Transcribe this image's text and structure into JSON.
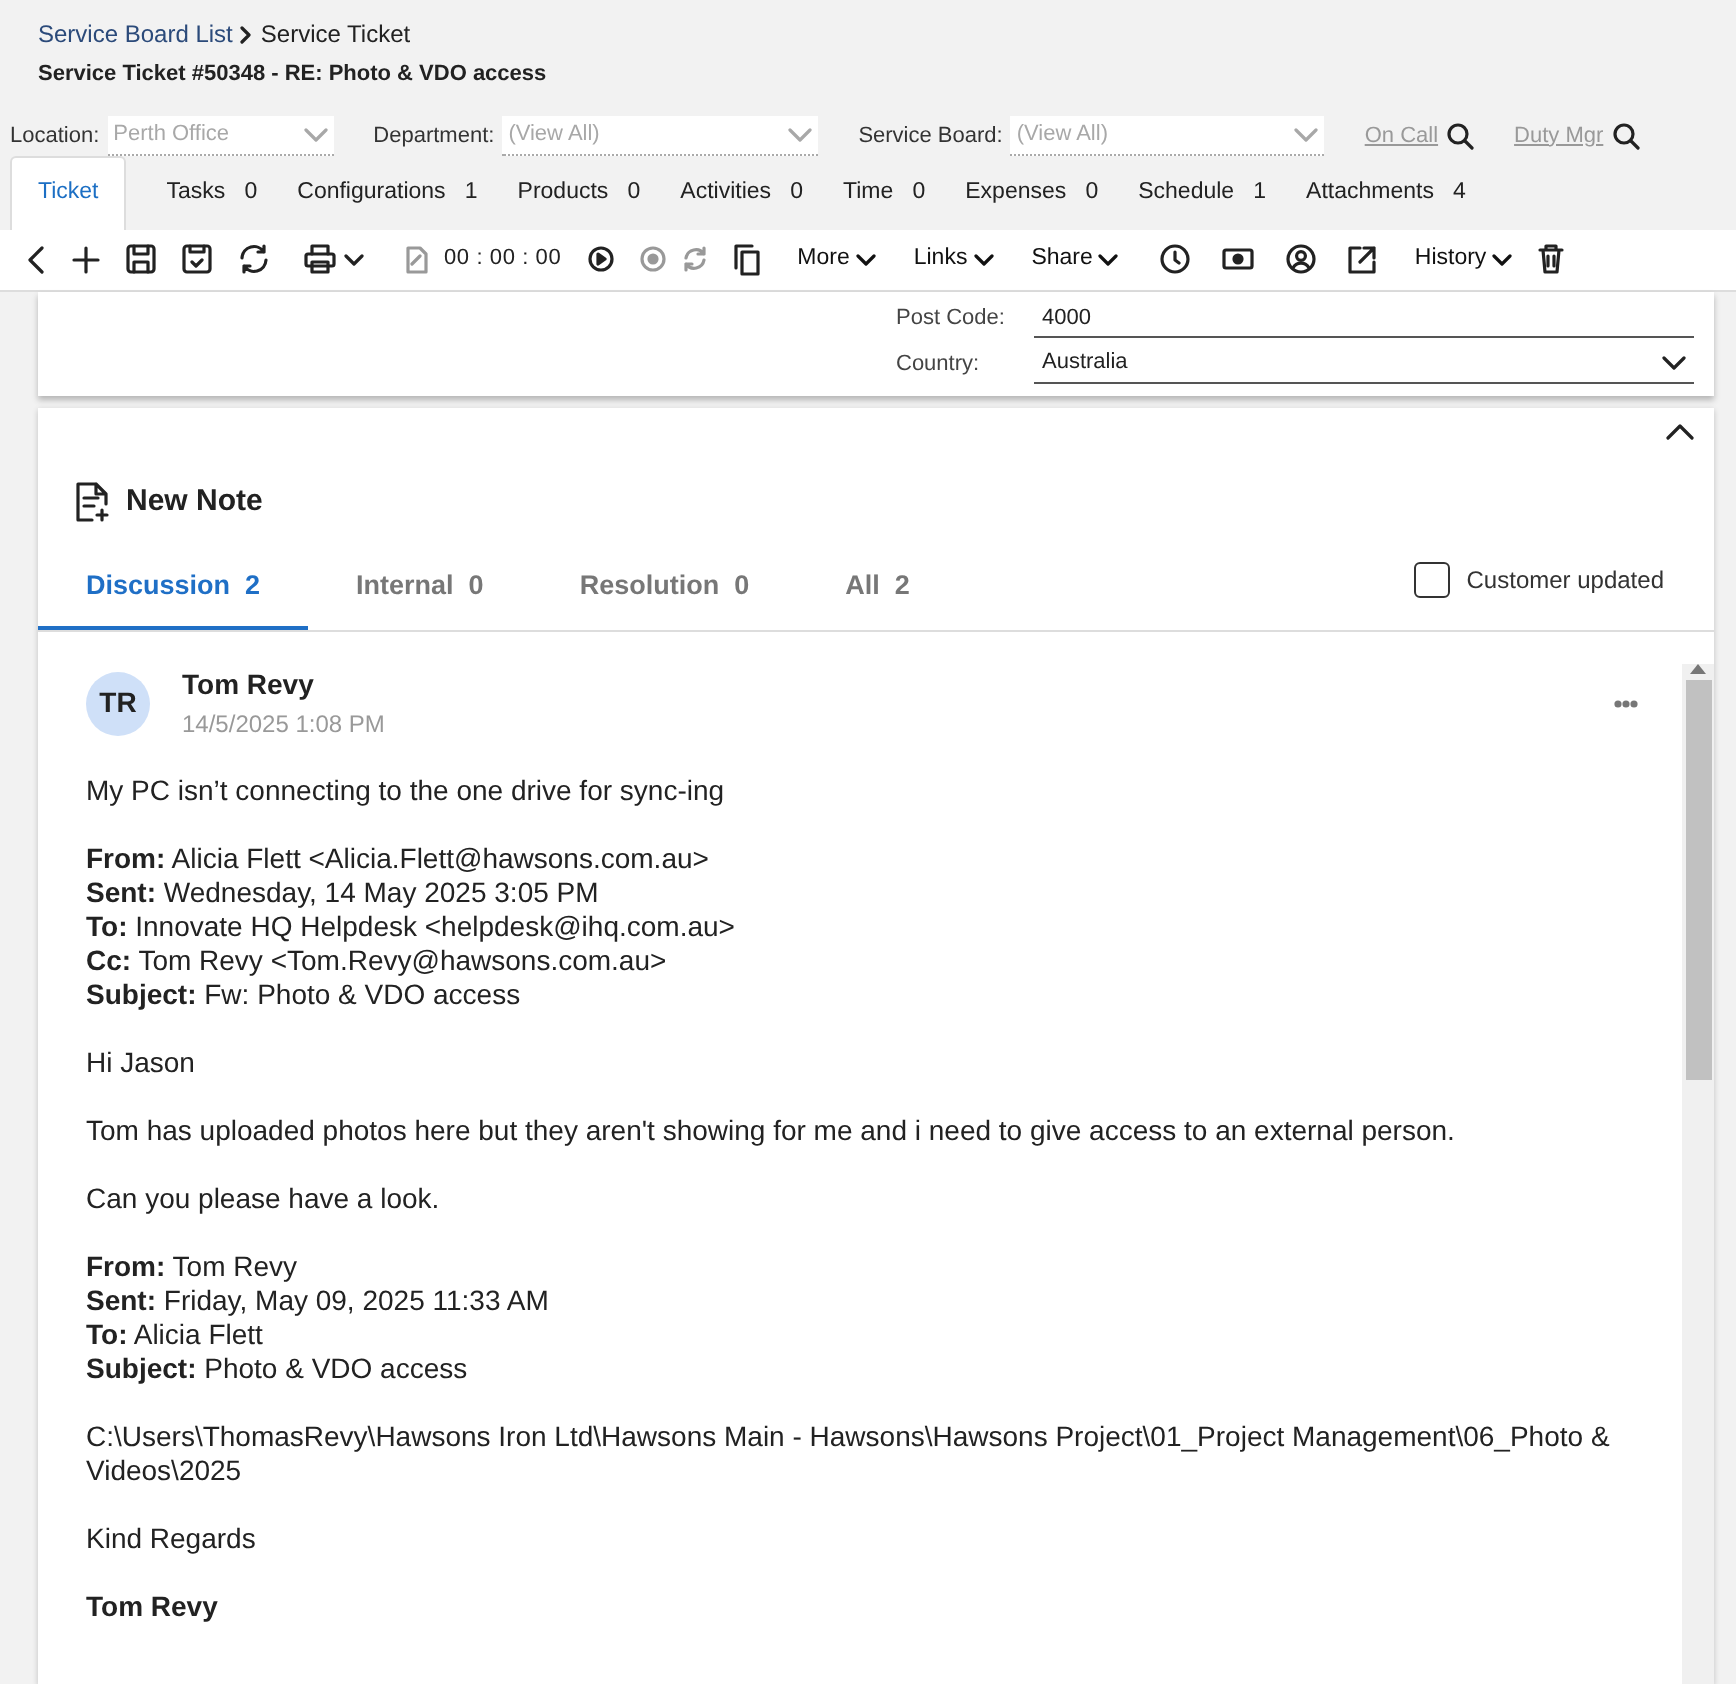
{
  "breadcrumb": {
    "parent": "Service Board List",
    "current": "Service Ticket"
  },
  "title": "Service Ticket #50348 - RE: Photo & VDO access",
  "filters": [
    {
      "label": "Location:",
      "value": "Perth Office",
      "disabled": true
    },
    {
      "label": "Department:",
      "value": "(View All)",
      "disabled": true
    },
    {
      "label": "Service Board:",
      "value": "(View All)",
      "disabled": true
    }
  ],
  "lookups": [
    "On Call",
    "Duty Mgr"
  ],
  "tabs": [
    {
      "label": "Ticket",
      "selected": true
    },
    {
      "label": "Tasks",
      "count": "0",
      "selected": false
    },
    {
      "label": "Configurations",
      "count": "1",
      "selected": false
    },
    {
      "label": "Products",
      "count": "0",
      "selected": false
    },
    {
      "label": "Activities",
      "count": "0",
      "selected": false
    },
    {
      "label": "Time",
      "count": "0",
      "selected": false
    },
    {
      "label": "Expenses",
      "count": "0",
      "selected": false
    },
    {
      "label": "Schedule",
      "count": "1",
      "selected": false
    },
    {
      "label": "Attachments",
      "count": "4",
      "selected": false
    }
  ],
  "toolbar": {
    "timer": "00 : 00 : 00",
    "menus": [
      "More",
      "Links",
      "Share",
      "History"
    ]
  },
  "address_fields": [
    {
      "label": "Post Code:",
      "value": "4000",
      "kind": "text"
    },
    {
      "label": "Country:",
      "value": "Australia",
      "kind": "select"
    }
  ],
  "notes": {
    "title": "New Note",
    "tabs": [
      {
        "label": "Discussion",
        "count": "2",
        "selected": true
      },
      {
        "label": "Internal",
        "count": "0",
        "selected": false
      },
      {
        "label": "Resolution",
        "count": "0",
        "selected": false
      },
      {
        "label": "All",
        "count": "2",
        "selected": false
      }
    ],
    "customer_updated": {
      "label": "Customer updated",
      "checked": false
    },
    "messages": [
      {
        "initials": "TR",
        "author": "Tom Revy",
        "time": "14/5/2025 1:08 PM",
        "paragraphs": [
          [
            "My PC isn’t connecting to the one drive for sync-ing"
          ],
          [
            "**From:** Alicia Flett <Alicia.Flett@hawsons.com.au>",
            "**Sent:** Wednesday, 14 May 2025 3:05 PM",
            "**To:** Innovate HQ Helpdesk <helpdesk@ihq.com.au>",
            "**Cc:** Tom Revy <Tom.Revy@hawsons.com.au>",
            "**Subject:** Fw: Photo & VDO access"
          ],
          [
            "Hi Jason"
          ],
          [
            "Tom has uploaded photos here but they aren't showing for me and i need to give access to an external person."
          ],
          [
            "Can you please have a look."
          ],
          [
            "**From:** Tom Revy",
            "**Sent:** Friday, May 09, 2025 11:33 AM",
            "**To:** Alicia Flett",
            "**Subject:** Photo & VDO access"
          ],
          [
            "C:\\Users\\ThomasRevy\\Hawsons Iron Ltd\\Hawsons Main - Hawsons\\Hawsons Project\\01_Project Management\\06_Photo & Videos\\2025"
          ],
          [
            "Kind Regards"
          ],
          [
            "**Tom Revy**"
          ]
        ]
      }
    ]
  }
}
